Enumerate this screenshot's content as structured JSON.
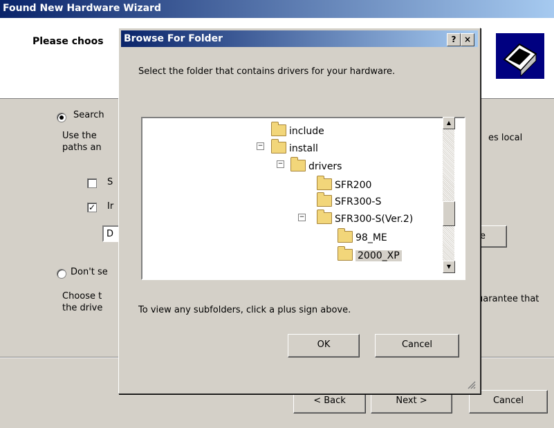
{
  "wizard": {
    "title": "Found New Hardware Wizard",
    "heading": "Please choos",
    "option_search_label": "Search",
    "search_desc_line1": "Use the",
    "search_desc_line2": "paths an",
    "search_desc_tail": "es local",
    "check1_label": "S",
    "check2_label": "Ir",
    "path_value": "D",
    "browse_tail": "e",
    "option_dont_label": "Don't se",
    "dont_desc_line1": "Choose t",
    "dont_desc_line2": "the drive",
    "dont_desc_tail": "uarantee that",
    "back_label": "< Back",
    "next_label": "Next >",
    "cancel_label": "Cancel"
  },
  "browse": {
    "title": "Browse For Folder",
    "help_label": "?",
    "close_label": "×",
    "instruction": "Select the folder that contains drivers for your hardware.",
    "hint": "To view any subfolders, click a plus sign above.",
    "ok_label": "OK",
    "cancel_label": "Cancel",
    "tree": [
      {
        "label": "include",
        "expander": ""
      },
      {
        "label": "install",
        "expander": "−"
      },
      {
        "label": "drivers",
        "expander": "−"
      },
      {
        "label": "SFR200",
        "expander": ""
      },
      {
        "label": "SFR300-S",
        "expander": ""
      },
      {
        "label": "SFR300-S(Ver.2)",
        "expander": "−"
      },
      {
        "label": "98_ME",
        "expander": ""
      },
      {
        "label": "2000_XP",
        "expander": "",
        "selected": true
      }
    ],
    "scroll_up_icon": "▲",
    "scroll_down_icon": "▼"
  }
}
